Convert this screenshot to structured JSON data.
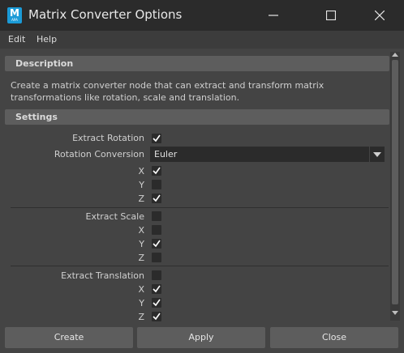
{
  "window": {
    "app_icon_letter": "M",
    "app_icon_sub": "APA",
    "title": "Matrix Converter Options"
  },
  "menubar": {
    "items": [
      {
        "label": "Edit"
      },
      {
        "label": "Help"
      }
    ]
  },
  "description": {
    "header": "Description",
    "text": "Create a matrix converter node that can extract and transform matrix transformations like rotation, scale and translation."
  },
  "settings": {
    "header": "Settings",
    "extract_rotation": {
      "label": "Extract Rotation",
      "checked": true
    },
    "rotation_conversion": {
      "label": "Rotation Conversion",
      "value": "Euler"
    },
    "rotation_axes": [
      {
        "label": "X",
        "checked": true
      },
      {
        "label": "Y",
        "checked": false
      },
      {
        "label": "Z",
        "checked": true
      }
    ],
    "extract_scale": {
      "label": "Extract Scale",
      "checked": false
    },
    "scale_axes": [
      {
        "label": "X",
        "checked": false
      },
      {
        "label": "Y",
        "checked": true
      },
      {
        "label": "Z",
        "checked": false
      }
    ],
    "extract_translation": {
      "label": "Extract Translation",
      "checked": false
    },
    "translation_axes": [
      {
        "label": "X",
        "checked": true
      },
      {
        "label": "Y",
        "checked": true
      },
      {
        "label": "Z",
        "checked": true
      }
    ]
  },
  "buttons": {
    "create": "Create",
    "apply": "Apply",
    "close": "Close"
  },
  "colors": {
    "app_icon": "#1b9bd7",
    "window_bg": "#444444",
    "titlebar_bg": "#2b2b2b",
    "section_header_bg": "#5d5d5d",
    "checkbox_bg": "#2b2b2b"
  }
}
